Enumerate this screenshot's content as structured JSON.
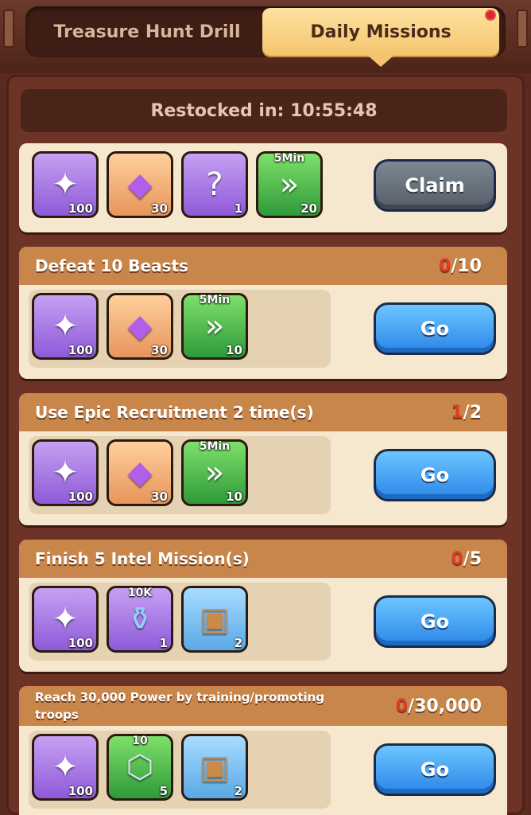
{
  "tabs": [
    {
      "label": "Treasure Hunt Drill"
    },
    {
      "label": "Daily Missions"
    }
  ],
  "restock": {
    "label": "Restocked in: 10:55:48"
  },
  "missions": [
    {
      "title": "",
      "progress_current": "",
      "progress_total": "",
      "button": "Claim",
      "rewards": [
        {
          "icon": "shuriken-icon",
          "count": "100",
          "top": ""
        },
        {
          "icon": "purple-gem-icon",
          "count": "30",
          "top": ""
        },
        {
          "icon": "mystery-chest-icon",
          "count": "1",
          "top": ""
        },
        {
          "icon": "speedup-icon",
          "count": "20",
          "top": "5Min"
        }
      ]
    },
    {
      "title": "Defeat 10 Beasts",
      "progress_current": "0",
      "progress_total": "/10",
      "button": "Go",
      "rewards": [
        {
          "icon": "shuriken-icon",
          "count": "100",
          "top": ""
        },
        {
          "icon": "purple-gem-icon",
          "count": "30",
          "top": ""
        },
        {
          "icon": "speedup-icon",
          "count": "10",
          "top": "5Min"
        }
      ]
    },
    {
      "title": "Use Epic Recruitment 2 time(s)",
      "progress_current": "1",
      "progress_total": "/2",
      "button": "Go",
      "rewards": [
        {
          "icon": "shuriken-icon",
          "count": "100",
          "top": ""
        },
        {
          "icon": "purple-gem-icon",
          "count": "30",
          "top": ""
        },
        {
          "icon": "speedup-icon",
          "count": "10",
          "top": "5Min"
        }
      ]
    },
    {
      "title": "Finish 5 Intel Mission(s)",
      "progress_current": "0",
      "progress_total": "/5",
      "button": "Go",
      "rewards": [
        {
          "icon": "shuriken-icon",
          "count": "100",
          "top": ""
        },
        {
          "icon": "xp-potion-icon",
          "count": "1",
          "top": "10K"
        },
        {
          "icon": "treasure-chest-icon",
          "count": "2",
          "top": ""
        }
      ]
    },
    {
      "title": "Reach 30,000 Power by training/promoting troops",
      "progress_current": "0",
      "progress_total": "/30,000",
      "button": "Go",
      "rewards": [
        {
          "icon": "shuriken-icon",
          "count": "100",
          "top": ""
        },
        {
          "icon": "hex-nut-icon",
          "count": "5",
          "top": "10"
        },
        {
          "icon": "treasure-chest-icon",
          "count": "2",
          "top": ""
        }
      ]
    }
  ]
}
